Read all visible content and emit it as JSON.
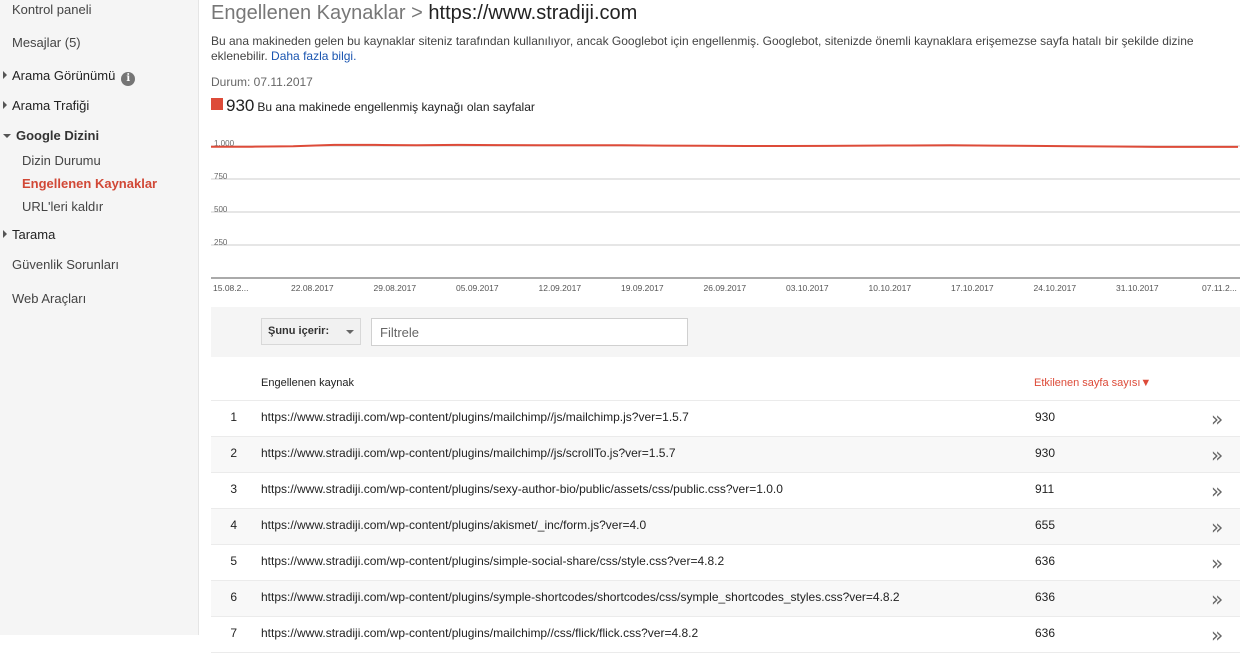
{
  "sidebar": {
    "items": [
      {
        "label": "Kontrol paneli"
      },
      {
        "label": "Mesajlar (5)"
      },
      {
        "label": "Arama Görünümü"
      },
      {
        "label": "Arama Trafiği"
      },
      {
        "label": "Google Dizini"
      },
      {
        "label": "Dizin Durumu"
      },
      {
        "label": "Engellenen Kaynaklar"
      },
      {
        "label": "URL'leri kaldır"
      },
      {
        "label": "Tarama"
      },
      {
        "label": "Güvenlik Sorunları"
      },
      {
        "label": "Web Araçları"
      }
    ],
    "info_icon": "i"
  },
  "header": {
    "title": "Engellenen Kaynaklar >",
    "site": "https://www.stradiji.com",
    "description": "Bu ana makineden gelen bu kaynaklar siteniz tarafından kullanılıyor, ancak Googlebot için engellenmiş. Googlebot, sitenizde önemli kaynaklara erişemezse sayfa hatalı bir şekilde dizine eklenebilir.",
    "learn_more": "Daha fazla bilgi.",
    "status": "Durum: 07.11.2017",
    "legend_value": "930",
    "legend_label": "Bu ana makinede engellenmiş kaynağı olan sayfalar"
  },
  "chart_data": {
    "type": "line",
    "y_ticks": [
      "1.000",
      "750",
      "500",
      "250"
    ],
    "ylim": [
      0,
      1000
    ],
    "x_ticks": [
      "15.08.2...",
      "22.08.2017",
      "29.08.2017",
      "05.09.2017",
      "12.09.2017",
      "19.09.2017",
      "26.09.2017",
      "03.10.2017",
      "10.10.2017",
      "17.10.2017",
      "24.10.2017",
      "31.10.2017",
      "07.11.2..."
    ],
    "series": [
      {
        "color": "#dd4b39",
        "values": [
          995,
          995,
          998,
          1008,
          1008,
          1006,
          1008,
          1007,
          1006,
          1005,
          1005,
          1003,
          1002,
          1000,
          1000,
          1001,
          1003,
          1004,
          1005,
          1003,
          1001,
          998,
          996,
          993,
          993,
          993
        ]
      }
    ],
    "grid": true
  },
  "filter": {
    "select_label": "Şunu içerir:",
    "placeholder": "Filtrele"
  },
  "table": {
    "col_resource": "Engellenen kaynak",
    "col_count": "Etkilenen sayfa sayısı▼",
    "rows": [
      {
        "num": "1",
        "url": "https://www.stradiji.com/wp-content/plugins/mailchimp//js/mailchimp.js?ver=1.5.7",
        "count": "930"
      },
      {
        "num": "2",
        "url": "https://www.stradiji.com/wp-content/plugins/mailchimp//js/scrollTo.js?ver=1.5.7",
        "count": "930"
      },
      {
        "num": "3",
        "url": "https://www.stradiji.com/wp-content/plugins/sexy-author-bio/public/assets/css/public.css?ver=1.0.0",
        "count": "911"
      },
      {
        "num": "4",
        "url": "https://www.stradiji.com/wp-content/plugins/akismet/_inc/form.js?ver=4.0",
        "count": "655"
      },
      {
        "num": "5",
        "url": "https://www.stradiji.com/wp-content/plugins/simple-social-share/css/style.css?ver=4.8.2",
        "count": "636"
      },
      {
        "num": "6",
        "url": "https://www.stradiji.com/wp-content/plugins/symple-shortcodes/shortcodes/css/symple_shortcodes_styles.css?ver=4.8.2",
        "count": "636"
      },
      {
        "num": "7",
        "url": "https://www.stradiji.com/wp-content/plugins/mailchimp//css/flick/flick.css?ver=4.8.2",
        "count": "636"
      }
    ],
    "row_action_icon": "»"
  }
}
